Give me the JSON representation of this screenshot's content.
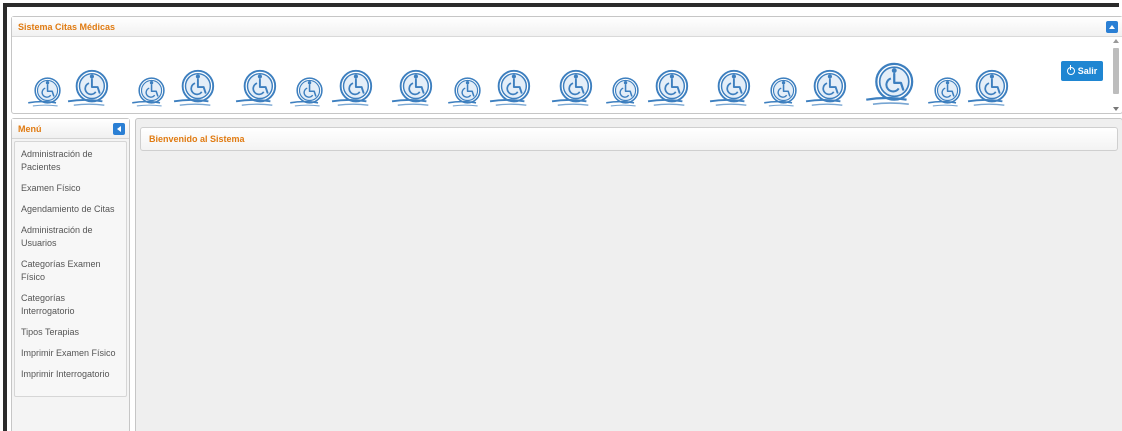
{
  "app": {
    "title": "Sistema Citas Médicas"
  },
  "toolbar": {
    "exit_label": "Salir"
  },
  "menu": {
    "title": "Menú",
    "items": [
      "Administración de Pacientes",
      "Examen Físico",
      "Agendamiento de Citas",
      "Administración de Usuarios",
      "Categorías Examen Físico",
      "Categorías Interrogatorio",
      "Tipos Terapias",
      "Imprimir Examen Físico",
      "Imprimir Interrogatorio"
    ]
  },
  "center": {
    "tab_title": "Bienvenido al Sistema"
  },
  "icons": {
    "banner_logo": "wheelchair-icon",
    "exit": "power-icon"
  },
  "colors": {
    "accent_orange": "#e07b12",
    "primary_blue": "#1f86d2",
    "logo_blue": "#3d7fbf"
  }
}
